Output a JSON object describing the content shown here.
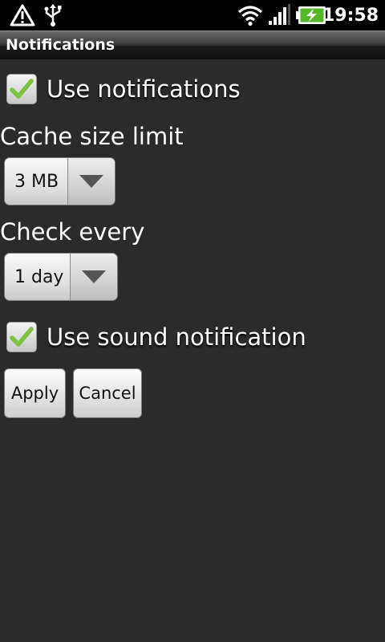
{
  "statusbar": {
    "clock": "19:58",
    "icons": [
      "alert-triangle-icon",
      "usb-icon",
      "wifi-icon",
      "signal-icon",
      "battery-charging-icon"
    ]
  },
  "titlebar": {
    "title": "Notifications"
  },
  "settings": {
    "use_notifications": {
      "label": "Use notifications",
      "checked": true
    },
    "cache_size": {
      "label": "Cache size limit",
      "value": "3 MB"
    },
    "check_every": {
      "label": "Check every",
      "value": "1 day"
    },
    "use_sound": {
      "label": "Use sound notification",
      "checked": true
    }
  },
  "actions": {
    "apply_label": "Apply",
    "cancel_label": "Cancel"
  },
  "colors": {
    "background": "#2b2b2b",
    "check_green": "#7fc241",
    "statusbar": "#000000"
  }
}
